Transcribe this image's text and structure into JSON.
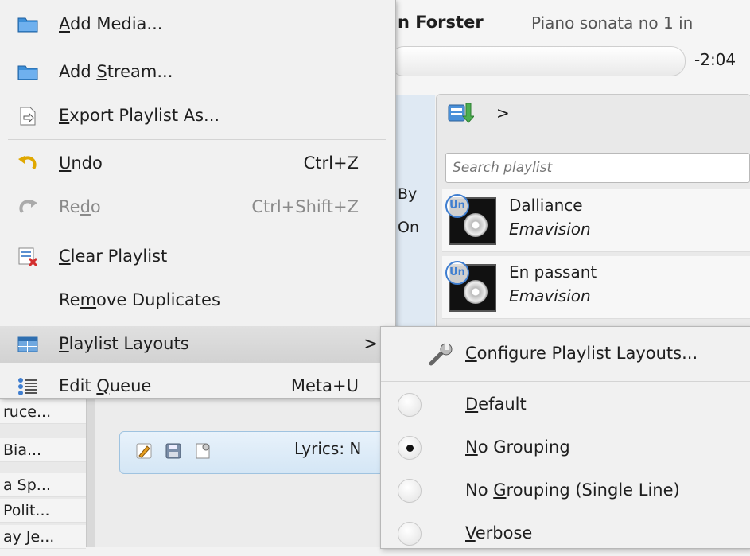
{
  "now_playing": {
    "artist_fragment": "n Forster",
    "title_fragment": "Piano sonata no 1 in",
    "time_remaining": "-2:04"
  },
  "background": {
    "left_fragments": [
      "By",
      "On"
    ],
    "column_cells": [
      "ruce...",
      "Bia...",
      "a Sp...",
      "Polit...",
      "ay Je..."
    ],
    "lyrics_label": "Lyrics: N"
  },
  "playlist": {
    "search_placeholder": "Search playlist",
    "chevron": ">",
    "badge": "Un",
    "tracks": [
      {
        "title": "Dalliance",
        "artist": "Emavision"
      },
      {
        "title": "En passant",
        "artist": "Emavision"
      }
    ]
  },
  "menu": {
    "items": [
      {
        "pre": "",
        "key": "A",
        "post": "dd Media...",
        "shortcut": "",
        "icon": "folder-icon"
      },
      {
        "pre": "Add ",
        "key": "S",
        "post": "tream...",
        "shortcut": "",
        "icon": "folder-icon"
      },
      {
        "pre": "",
        "key": "E",
        "post": "xport Playlist As...",
        "shortcut": "",
        "icon": "export-document-icon"
      },
      {
        "pre": "",
        "key": "U",
        "post": "ndo",
        "shortcut": "Ctrl+Z",
        "icon": "undo-icon"
      },
      {
        "pre": "Re",
        "key": "d",
        "post": "o",
        "shortcut": "Ctrl+Shift+Z",
        "icon": "redo-icon"
      },
      {
        "pre": "",
        "key": "C",
        "post": "lear Playlist",
        "shortcut": "",
        "icon": "clear-playlist-icon"
      },
      {
        "pre": "Re",
        "key": "m",
        "post": "ove Duplicates",
        "shortcut": "",
        "icon": ""
      },
      {
        "pre": "",
        "key": "P",
        "post": "laylist Layouts",
        "shortcut": ">",
        "icon": "playlist-layouts-icon"
      },
      {
        "pre": "Edit ",
        "key": "Q",
        "post": "ueue",
        "shortcut": "Meta+U",
        "icon": "queue-icon"
      }
    ]
  },
  "submenu": {
    "items": [
      {
        "pre": "",
        "key": "C",
        "post": "onfigure Playlist Layouts...",
        "selected": false
      },
      {
        "pre": "",
        "key": "D",
        "post": "efault",
        "selected": false
      },
      {
        "pre": "",
        "key": "N",
        "post": "o Grouping",
        "selected": true
      },
      {
        "pre": "No ",
        "key": "G",
        "post": "rouping (Single Line)",
        "selected": false
      },
      {
        "pre": "",
        "key": "V",
        "post": "erbose",
        "selected": false
      }
    ]
  },
  "colors": {
    "menu_bg": "#f1f1f1",
    "highlight": "#d6d6d6",
    "folder_blue": "#3d8fd8",
    "accent_blue": "#3f7ed0"
  }
}
